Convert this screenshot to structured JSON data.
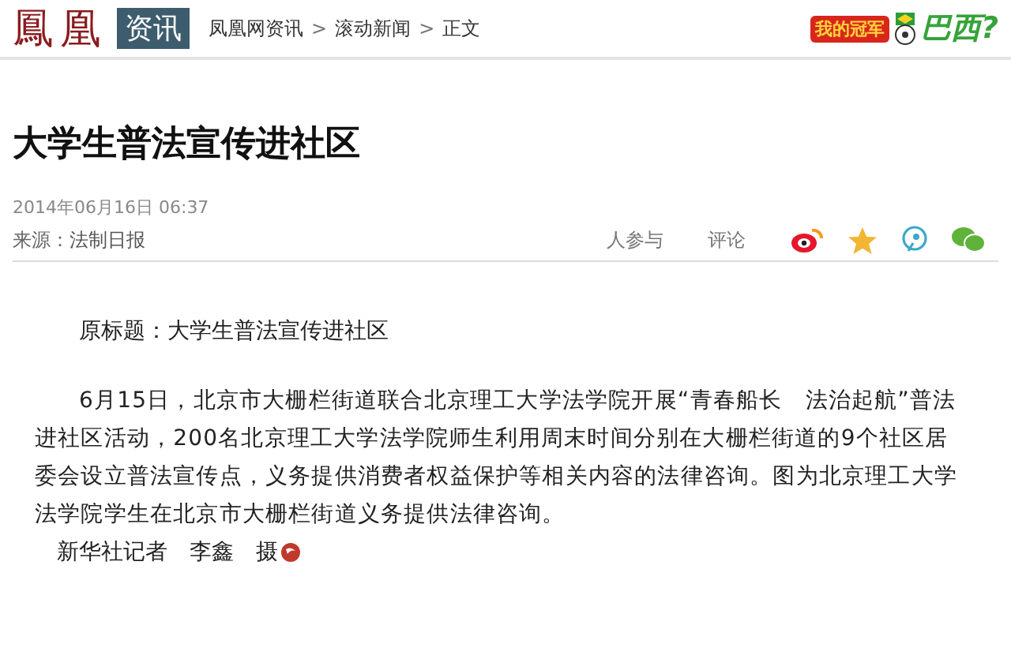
{
  "header": {
    "logo": "鳳凰",
    "channel": "资讯",
    "breadcrumb": [
      "凤凰网资讯",
      "滚动新闻",
      "正文"
    ],
    "breadcrumb_separator": ">",
    "promo": {
      "badge": "我的冠军",
      "answer": "巴西?"
    }
  },
  "article": {
    "title": "大学生普法宣传进社区",
    "date": "2014年06月16日  06:37",
    "source_label": "来源：",
    "source": "法制日报",
    "participants": "人参与",
    "comments": "评论"
  },
  "body": {
    "original_title": "原标题：大学生普法宣传进社区",
    "paragraph": "6月15日，北京市大栅栏街道联合北京理工大学法学院开展“青春船长　法治起航”普法进社区活动，200名北京理工大学法学院师生利用周末时间分别在大栅栏街道的9个社区居委会设立普法宣传点，义务提供消费者权益保护等相关内容的法律咨询。图为北京理工大学法学院学生在北京市大栅栏街道义务提供法律咨询。",
    "credit": "新华社记者　李鑫　摄"
  }
}
